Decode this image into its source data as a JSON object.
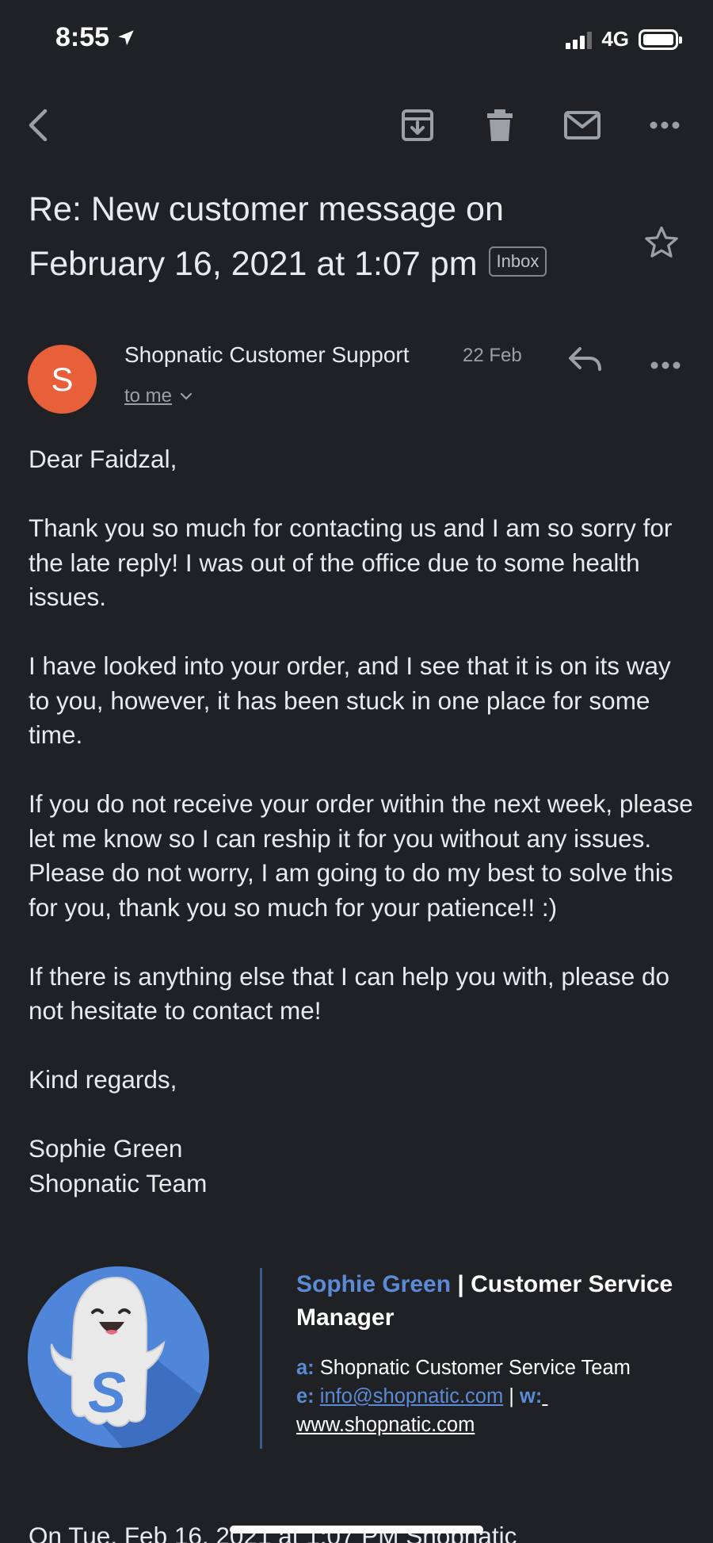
{
  "status_bar": {
    "time": "8:55",
    "network": "4G"
  },
  "email": {
    "subject": "Re: New customer message on February 16, 2021 at 1:07 pm",
    "label_badge": "Inbox",
    "sender": {
      "initial": "S",
      "name": "Shopnatic Customer Support",
      "date": "22 Feb",
      "recipient_label": "to me"
    },
    "body": [
      "Dear Faidzal,",
      "Thank you so much for contacting us and I am so sorry for the late reply! I was out of the office due to some health issues.",
      "I have looked into your order, and I see that it is on its way to you, however, it has been stuck in one place for some time.",
      "If you do not receive your order within the next week, please let me know so I can reship it for you without any issues. Please do not worry, I am going to do my best to solve this for you, thank you so much for your patience!! :)",
      "If there is anything else that I can help you with, please do not hesitate to contact me!",
      "Kind regards,"
    ],
    "closing_name": "Sophie Green",
    "closing_team": "Shopnatic Team",
    "signature": {
      "name": "Sophie Green",
      "separator": " | ",
      "role": "Customer Service Manager",
      "a_key": "a:",
      "a_value": "Shopnatic Customer Service Team",
      "e_key": "e:",
      "e_value": "info@shopnatic.com",
      "divider": " | ",
      "w_key": "w:",
      "w_value": "www.shopnatic.com",
      "logo_letter": "S"
    },
    "quoted_header": "On Tue, Feb 16, 2021 at 1:07 PM Shopnatic"
  },
  "colors": {
    "background": "#202124",
    "avatar": "#e8603a",
    "signature_accent": "#5b8ad6"
  }
}
